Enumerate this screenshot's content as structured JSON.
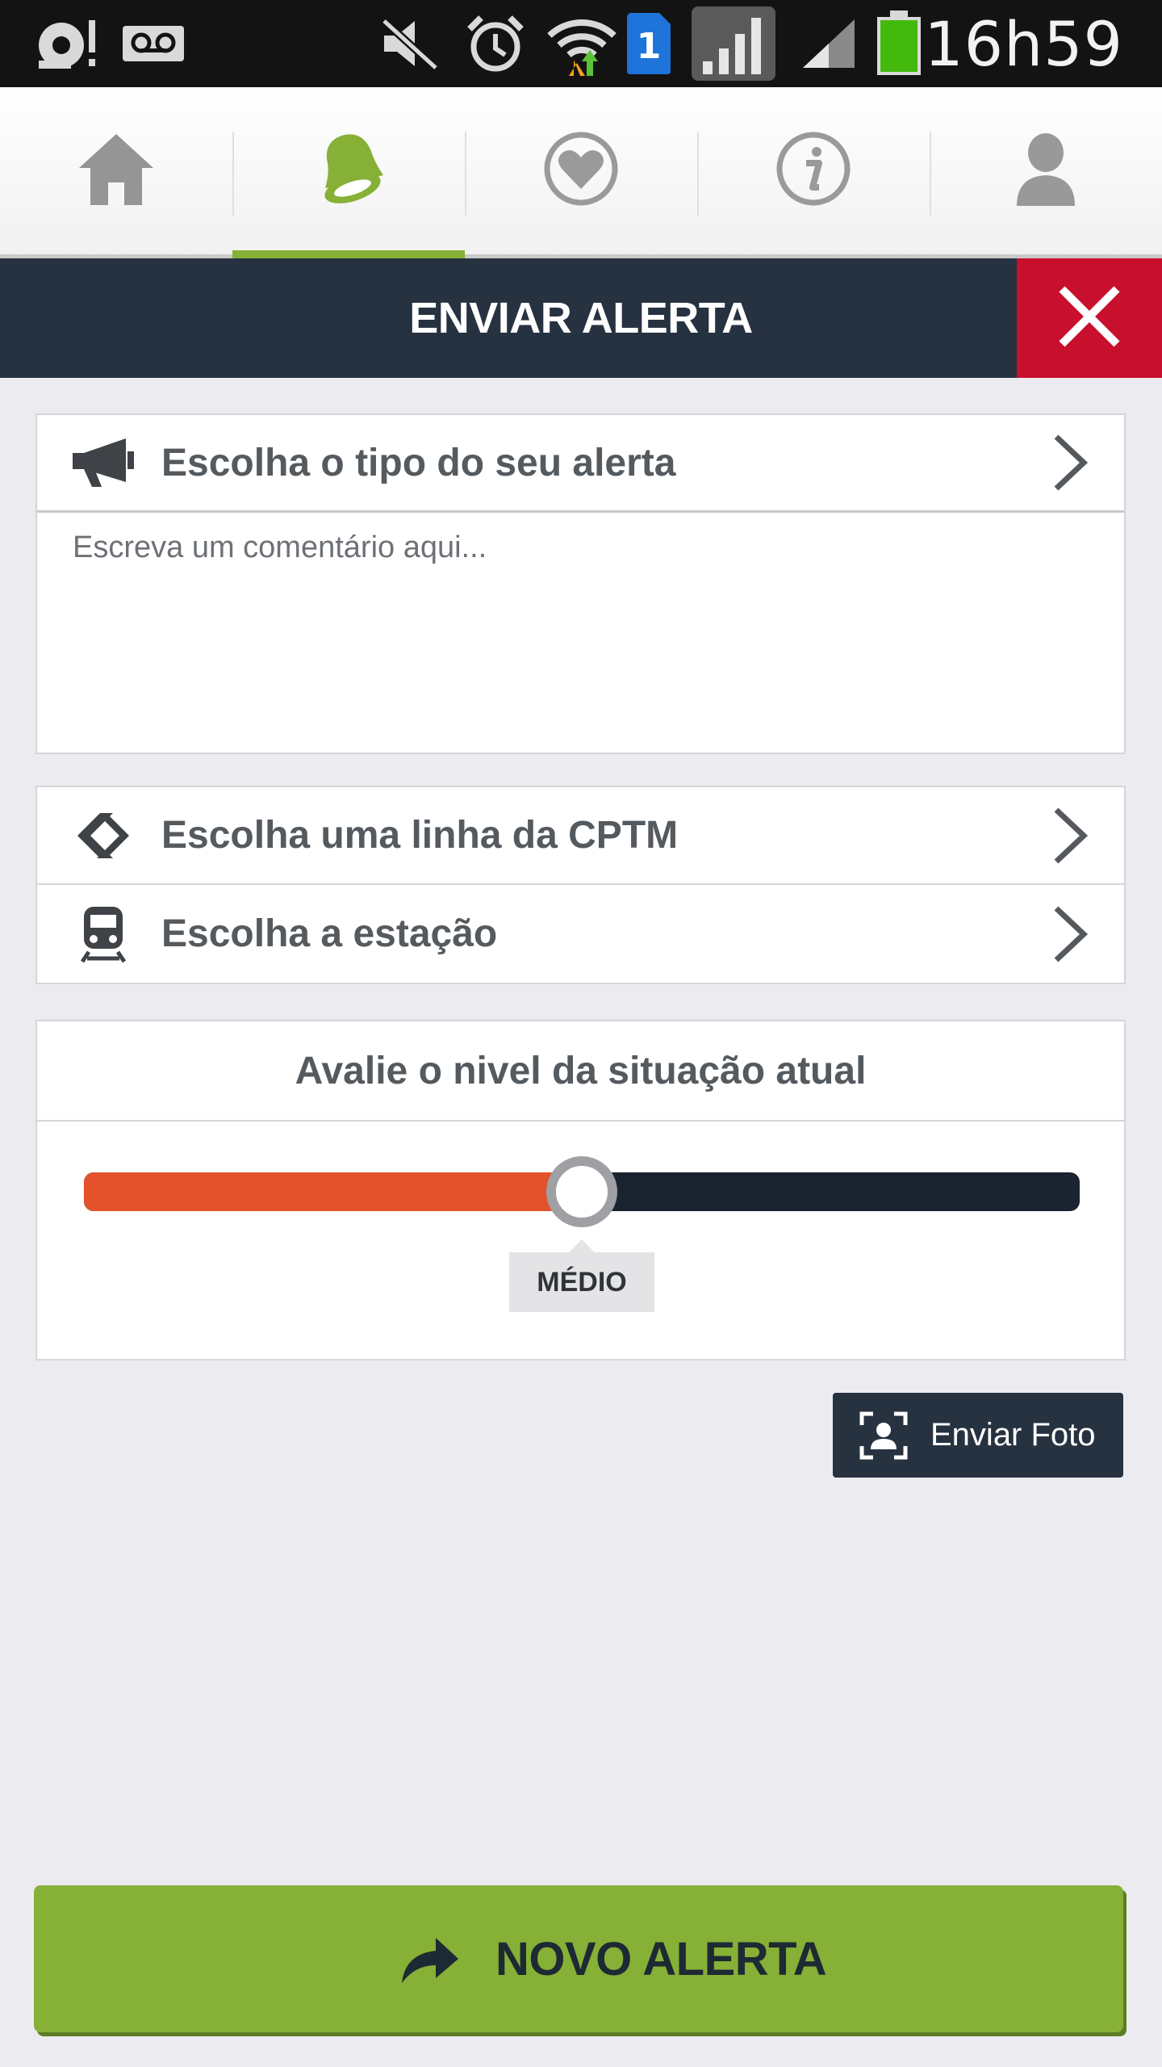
{
  "status_bar": {
    "time": "16h59",
    "sim_slot": "1",
    "icons": [
      "record-icon",
      "voicemail-icon",
      "mute-icon",
      "alarm-icon",
      "wifi-icon",
      "sim-icon",
      "signal-icon",
      "signal-icon",
      "battery-icon"
    ]
  },
  "tabs": [
    {
      "icon": "home-icon",
      "active": false
    },
    {
      "icon": "bell-icon",
      "active": true
    },
    {
      "icon": "heart-icon",
      "active": false
    },
    {
      "icon": "info-icon",
      "active": false
    },
    {
      "icon": "user-icon",
      "active": false
    }
  ],
  "header": {
    "title": "ENVIAR ALERTA",
    "close_icon": "close-icon"
  },
  "alert_type": {
    "label": "Escolha o tipo do seu alerta",
    "icon": "megaphone-icon"
  },
  "comment": {
    "placeholder": "Escreva um comentário aqui...",
    "value": ""
  },
  "line_select": {
    "label": "Escolha uma linha da CPTM",
    "icon": "cptm-logo-icon"
  },
  "station_select": {
    "label": "Escolha a estação",
    "icon": "train-icon"
  },
  "level": {
    "title": "Avalie o nivel da situação atual",
    "value_label": "MÉDIO",
    "value": 0.5
  },
  "photo_button": {
    "label": "Enviar Foto",
    "icon": "photo-portrait-icon"
  },
  "submit_button": {
    "label": "NOVO ALERTA",
    "icon": "share-arrow-icon"
  },
  "colors": {
    "accent_green": "#86b036",
    "header_navy": "#273241",
    "close_red": "#c8102e",
    "slider_fill": "#e3522a",
    "slider_track": "#1a2430"
  }
}
